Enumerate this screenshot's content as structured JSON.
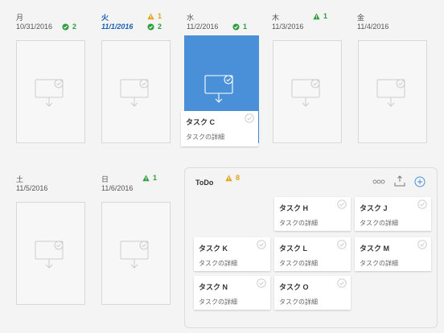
{
  "days": [
    {
      "name": "月",
      "date": "10/31/2016",
      "status": "ok",
      "count": "2"
    },
    {
      "name": "火",
      "date": "11/1/2016",
      "warn_count": "1",
      "status": "ok",
      "count": "2"
    },
    {
      "name": "水",
      "date": "11/2/2016",
      "status": "ok",
      "count": "1"
    },
    {
      "name": "木",
      "date": "11/3/2016",
      "status": "alert",
      "count": "1"
    },
    {
      "name": "金",
      "date": "11/4/2016"
    },
    {
      "name": "土",
      "date": "11/5/2016"
    },
    {
      "name": "日",
      "date": "11/6/2016",
      "status": "alert",
      "count": "1"
    }
  ],
  "dragged_card": {
    "title": "タスク C",
    "detail": "タスクの詳細"
  },
  "todo": {
    "title": "ToDo",
    "warn_count": "8",
    "cards": [
      {
        "title": "タスク H",
        "detail": "タスクの詳細"
      },
      {
        "title": "タスク J",
        "detail": "タスクの詳細"
      },
      {
        "title": "タスク K",
        "detail": "タスクの詳細"
      },
      {
        "title": "タスク L",
        "detail": "タスクの詳細"
      },
      {
        "title": "タスク M",
        "detail": "タスクの詳細"
      },
      {
        "title": "タスク N",
        "detail": "タスクの詳細"
      },
      {
        "title": "タスク O",
        "detail": "タスクの詳細"
      }
    ]
  },
  "icons": {
    "more": "more-icon",
    "export": "export-icon",
    "add": "add-icon"
  },
  "colors": {
    "accent": "#4a90d9",
    "ok": "#2e9e3e",
    "warn": "#e2a21a"
  }
}
